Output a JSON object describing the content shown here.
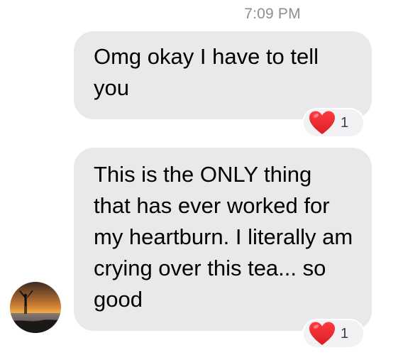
{
  "conversation": {
    "timestamp": "7:09 PM",
    "messages": [
      {
        "text": "Omg okay I have to tell you",
        "reaction": {
          "icon": "heart-icon",
          "count": "1"
        }
      },
      {
        "text": "This is the ONLY thing that has ever worked for my heartburn. I literally am crying over this tea... so good",
        "reaction": {
          "icon": "heart-icon",
          "count": "1"
        }
      }
    ],
    "sender_avatar": {
      "icon": "avatar-sunset-icon"
    }
  },
  "colors": {
    "bubble": "#e9e9eb",
    "timestamp": "#8e8e93",
    "heart": "#e8242d"
  }
}
